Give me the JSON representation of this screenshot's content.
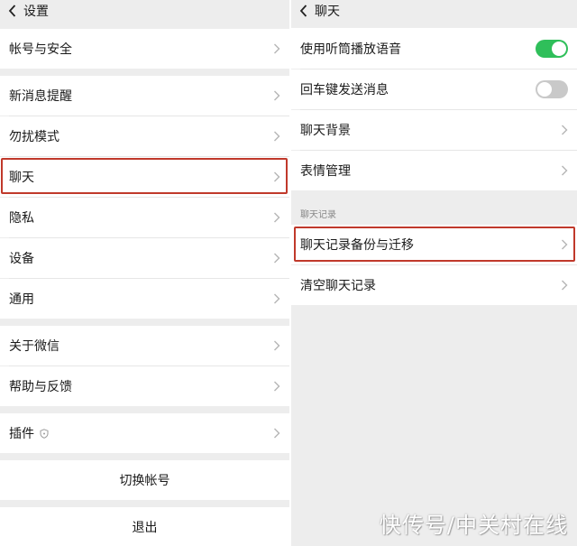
{
  "left": {
    "title": "设置",
    "items": [
      {
        "label": "帐号与安全"
      },
      {
        "label": "新消息提醒"
      },
      {
        "label": "勿扰模式"
      },
      {
        "label": "聊天"
      },
      {
        "label": "隐私"
      },
      {
        "label": "设备"
      },
      {
        "label": "通用"
      },
      {
        "label": "关于微信"
      },
      {
        "label": "帮助与反馈"
      },
      {
        "label": "插件"
      }
    ],
    "switch_account": "切换帐号",
    "logout": "退出"
  },
  "right": {
    "title": "聊天",
    "items": [
      {
        "label": "使用听筒播放语音",
        "toggle": "on"
      },
      {
        "label": "回车键发送消息",
        "toggle": "off"
      },
      {
        "label": "聊天背景"
      },
      {
        "label": "表情管理"
      }
    ],
    "section_title": "聊天记录",
    "history_items": [
      {
        "label": "聊天记录备份与迁移"
      },
      {
        "label": "清空聊天记录"
      }
    ]
  },
  "colors": {
    "toggle_on": "#2fbf5a",
    "toggle_off": "#c9c9c9",
    "highlight": "#c0392b"
  },
  "watermark": "快传号/中关村在线"
}
